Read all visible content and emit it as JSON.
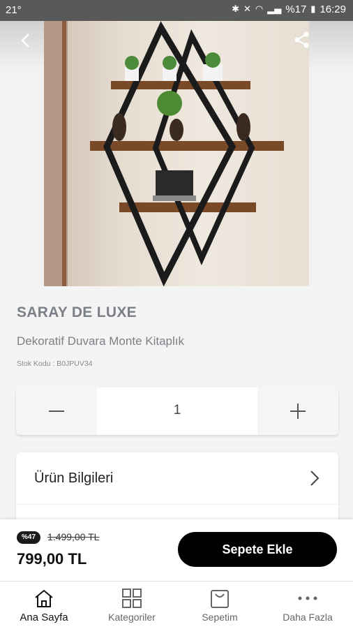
{
  "status_bar": {
    "left": "21°",
    "battery": "%17",
    "time": "16:29"
  },
  "product": {
    "brand": "SARAY DE LUXE",
    "name": "Dekoratif Duvara Monte Kitaplık",
    "sku": "Stok Kodu : B0JPUV34",
    "quantity": "1"
  },
  "info": {
    "label": "Ürün Bilgileri"
  },
  "pricing": {
    "discount_badge": "%47",
    "old_price": "1.499,00 TL",
    "price": "799,00 TL",
    "add_to_cart": "Sepete Ekle"
  },
  "tabs": [
    {
      "label": "Ana Sayfa",
      "icon": "home-icon",
      "active": true
    },
    {
      "label": "Kategoriler",
      "icon": "grid-icon",
      "active": false
    },
    {
      "label": "Sepetim",
      "icon": "cart-icon",
      "active": false
    },
    {
      "label": "Daha Fazla",
      "icon": "more-icon",
      "active": false
    }
  ]
}
